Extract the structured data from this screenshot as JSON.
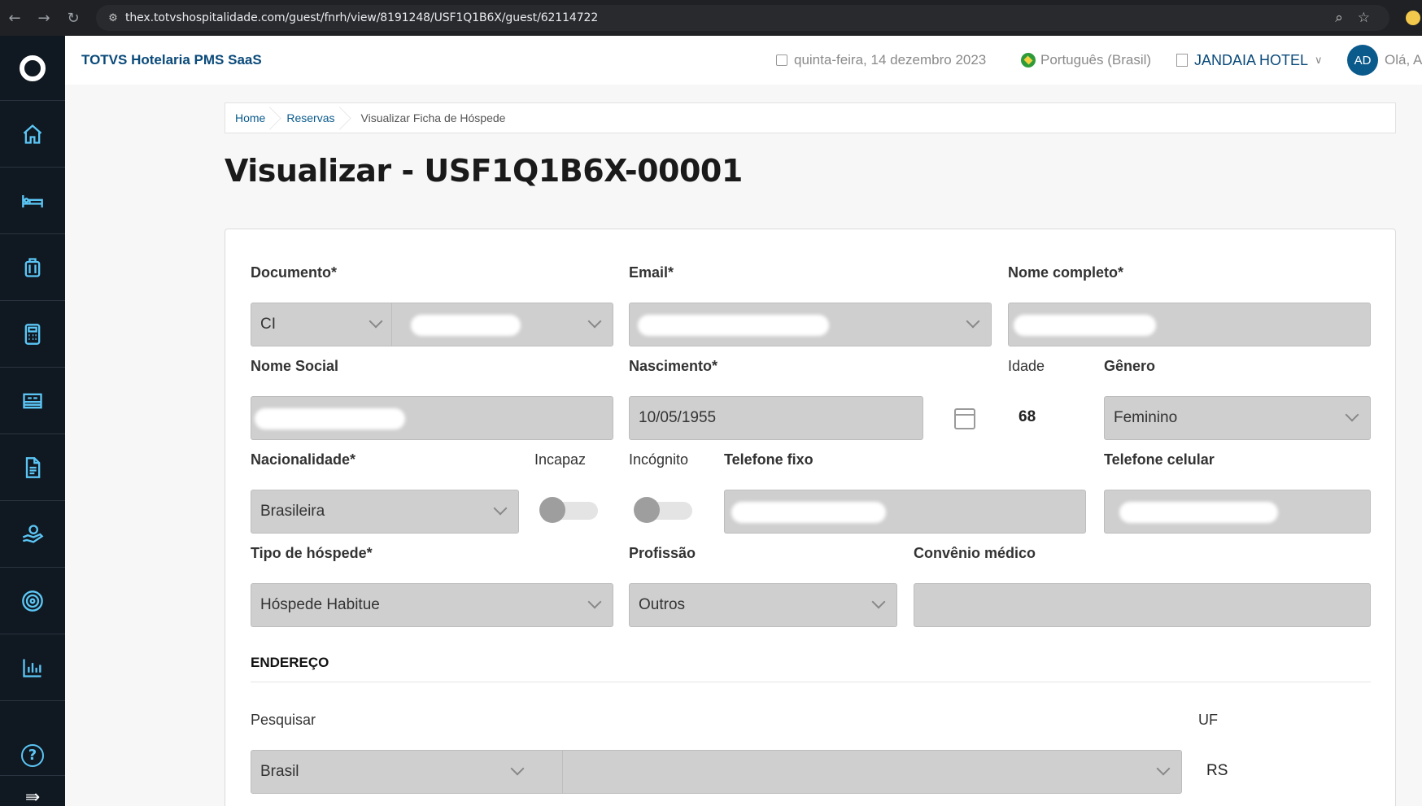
{
  "browser": {
    "url": "thex.totvshospitalidade.com/guest/fnrh/view/8191248/USF1Q1B6X/guest/62114722"
  },
  "sidebar": {
    "items": [
      {
        "icon": "home-icon"
      },
      {
        "icon": "bed-icon"
      },
      {
        "icon": "luggage-icon"
      },
      {
        "icon": "calculator-icon"
      },
      {
        "icon": "room-icon"
      },
      {
        "icon": "document-icon"
      },
      {
        "icon": "hand-money-icon"
      },
      {
        "icon": "target-icon"
      },
      {
        "icon": "report-chart-icon"
      }
    ],
    "help_label": "?",
    "expand_label": "⇛"
  },
  "header": {
    "app_title": "TOTVS Hotelaria PMS SaaS",
    "date": "quinta-feira, 14 dezembro 2023",
    "language": "Português (Brasil)",
    "hotel": "JANDAIA HOTEL",
    "avatar_initials": "AD",
    "greeting": "Olá, A"
  },
  "breadcrumb": {
    "items": [
      "Home",
      "Reservas"
    ],
    "current": "Visualizar Ficha de Hóspede"
  },
  "page": {
    "title": "Visualizar - USF1Q1B6X-00001"
  },
  "form": {
    "documento": {
      "label": "Documento*",
      "type_value": "CI"
    },
    "email": {
      "label": "Email*"
    },
    "nome_completo": {
      "label": "Nome completo*"
    },
    "nome_social": {
      "label": "Nome Social"
    },
    "nascimento": {
      "label": "Nascimento*",
      "value": "10/05/1955"
    },
    "idade": {
      "label": "Idade",
      "value": "68"
    },
    "genero": {
      "label": "Gênero",
      "value": "Feminino"
    },
    "nacionalidade": {
      "label": "Nacionalidade*",
      "value": "Brasileira"
    },
    "incapaz": {
      "label": "Incapaz",
      "checked": false
    },
    "incognito": {
      "label": "Incógnito",
      "checked": false
    },
    "telefone_fixo": {
      "label": "Telefone fixo"
    },
    "telefone_celular": {
      "label": "Telefone celular"
    },
    "tipo_hospede": {
      "label": "Tipo de hóspede*",
      "value": "Hóspede Habitue"
    },
    "profissao": {
      "label": "Profissão",
      "value": "Outros"
    },
    "convenio": {
      "label": "Convênio médico",
      "value": ""
    }
  },
  "endereco": {
    "section_title": "ENDEREÇO",
    "pesquisar": {
      "label": "Pesquisar",
      "country": "Brasil",
      "query": ""
    },
    "uf": {
      "label": "UF",
      "value": "RS"
    }
  },
  "colors": {
    "sidebar_bg": "#101821",
    "sidebar_icon": "#5bc6f5",
    "brand_blue": "#0a4a7a",
    "field_bg": "#cfcfcf"
  }
}
